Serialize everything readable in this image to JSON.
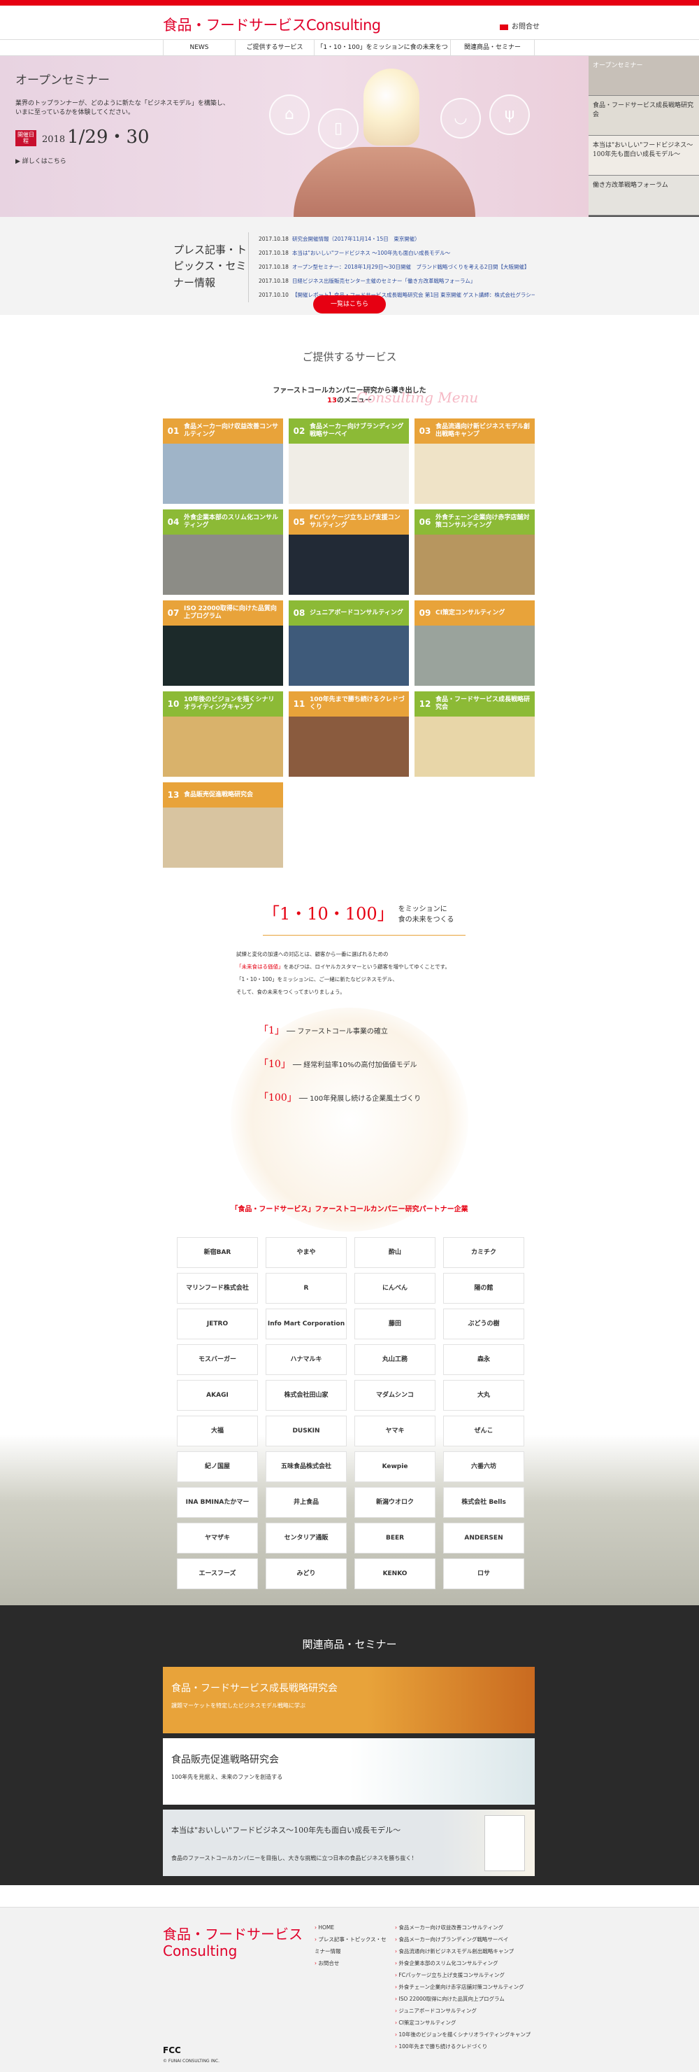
{
  "header": {
    "logo": "食品・フードサービスConsulting",
    "contact": "お問合せ",
    "nav": [
      "NEWS",
      "ご提供するサービス",
      "「1・10・100」をミッションに食の未来をつくる",
      "関連商品・セミナー"
    ]
  },
  "hero": {
    "title": "オープンセミナー",
    "desc1": "業界のトップランナーが、どのように新たな「ビジネスモデル」を構築し、",
    "desc2": "いまに至っているかを体験してください。",
    "badge": "開催日程",
    "year": "2018",
    "date": "1/29・30",
    "more": "詳しくはこちら",
    "side": [
      "オープンセミナー",
      "食品・フードサービス成長戦略研究会",
      "本当は\"おいしい\"フードビジネス〜100年先も面白い成長モデル〜",
      "働き方改革戦略フォーラム"
    ]
  },
  "news": {
    "title": "プレス記事・トピックス・セミナー情報",
    "items": [
      {
        "date": "2017.10.18",
        "text": "研究会開催情報（2017年11月14・15日　東京開催）"
      },
      {
        "date": "2017.10.18",
        "text": "本当は\"おいしい\"フードビジネス 〜100年先も面白い成長モデル〜"
      },
      {
        "date": "2017.10.18",
        "text": "オープン型セミナー：2018年1月29日〜30日開催　ブランド戦略づくりを考える2日間【大阪開催】"
      },
      {
        "date": "2017.10.18",
        "text": "日経ビジネス出版販売センター主催のセミナー「働き方改革戦略フォーラム」"
      },
      {
        "date": "2017.10.10",
        "text": "【開催レポート】食品・フードサービス成長戦略研究会 第1回 東京開催 ゲスト講師：株式会社グラシー..."
      }
    ],
    "more": "一覧はこちら"
  },
  "services": {
    "title": "ご提供するサービス",
    "lead1": "ファーストコールカンパニー研究から導き出した",
    "lead2_num": "13",
    "lead2_txt": "のメニュー",
    "script": "Consulting Menu",
    "tiles": [
      {
        "num": "01",
        "label": "食品メーカー向け収益改善コンサルティング"
      },
      {
        "num": "02",
        "label": "食品メーカー向けブランディング戦略サーベイ"
      },
      {
        "num": "03",
        "label": "食品流通向け新ビジネスモデル創出戦略キャンプ"
      },
      {
        "num": "04",
        "label": "外食企業本部のスリム化コンサルティング"
      },
      {
        "num": "05",
        "label": "FCパッケージ立ち上げ支援コンサルティング"
      },
      {
        "num": "06",
        "label": "外食チェーン企業向け赤字店舗対策コンサルティング"
      },
      {
        "num": "07",
        "label": "ISO 22000取得に向けた品質向上プログラム"
      },
      {
        "num": "08",
        "label": "ジュニアボードコンサルティング"
      },
      {
        "num": "09",
        "label": "CI策定コンサルティング"
      },
      {
        "num": "10",
        "label": "10年後のビジョンを描くシナリオライティングキャンプ"
      },
      {
        "num": "11",
        "label": "100年先まで勝ち続けるクレドづくり"
      },
      {
        "num": "12",
        "label": "食品・フードサービス成長戦略研究会"
      },
      {
        "num": "13",
        "label": "食品販売促進戦略研究会"
      }
    ]
  },
  "mission": {
    "title_mark": "「1・10・100」",
    "title_rest1": "をミッションに",
    "title_rest2": "食の未来をつくる",
    "body1": "試練と変化の加速への対応とは、顧客から一番に選ばれるための",
    "body2_red": "「未来食はる価値」",
    "body2_rest": "をあびつは、ロイヤルカスタマーという顧客を増やしてゆくことです。",
    "body3": "「1・10・100」をミッションに、ご一緒に新たなビジネスモデル、",
    "body4": "そして、食の未来をつくってまいりましょう。",
    "items": [
      {
        "mark": "「1」",
        "text": "ファーストコール事業の確立"
      },
      {
        "mark": "「10」",
        "text": "経常利益率10%の高付加価値モデル"
      },
      {
        "mark": "「100」",
        "text": "100年発展し続ける企業風土づくり"
      }
    ]
  },
  "partners": {
    "title": "「食品・フードサービス」ファーストコールカンパニー研究パートナー企業",
    "logos": [
      "新宿BAR",
      "やまや",
      "酔山",
      "カミチク",
      "マリンフード株式会社",
      "R",
      "にんべん",
      "陽の館",
      "JETRO",
      "Info Mart Corporation",
      "藤田",
      "ぶどうの樹",
      "モスバーガー",
      "ハナマルキ",
      "丸山工務",
      "森永",
      "AKAGI",
      "株式会社田山家",
      "マダムシンコ",
      "大丸",
      "大福",
      "DUSKIN",
      "ヤマキ",
      "ぜんこ",
      "紀ノ国屋",
      "五味食品株式会社",
      "Kewpie",
      "六番六坊",
      "INA BMINAたかマー",
      "井上食品",
      "新潟ウオロク",
      "株式会社 Bells",
      "ヤマザキ",
      "センタリア通販",
      "BEER",
      "ANDERSEN",
      "エースフーズ",
      "みどり",
      "KENKO",
      "ロサ"
    ]
  },
  "related": {
    "title": "関連商品・セミナー",
    "cards": [
      {
        "title": "食品・フードサービス成長戦略研究会",
        "sub": "課題マーケットを特定したビジネスモデル戦略に学ぶ"
      },
      {
        "title": "食品販売促進戦略研究会",
        "sub": "100年先を見据え、未来のファンを創造する"
      },
      {
        "title": "本当は\"おいしい\"フードビジネス〜100年先も面白い成長モデル〜",
        "sub": "食品のファーストコールカンパニーを目指し、大きな挑戦に立つ日本の食品ビジネスを勝ち抜く！"
      }
    ]
  },
  "footer": {
    "logo1": "食品・フードサービス",
    "logo2": "Consulting",
    "col1": [
      "HOME",
      "プレス記事・トピックス・セミナー情報",
      "お問合せ"
    ],
    "col2": [
      "食品メーカー向け収益改善コンサルティング",
      "食品メーカー向けブランディング戦略サーベイ",
      "食品流通向け新ビジネスモデル創出戦略キャンプ",
      "外食企業本部のスリム化コンサルティング",
      "FCパッケージ立ち上げ支援コンサルティング",
      "外食チェーン企業向け赤字店舗対策コンサルティング",
      "ISO 22000取得に向けた品質向上プログラム",
      "ジュニアボードコンサルティング",
      "CI策定コンサルティング",
      "10年後のビジョンを描くシナリオライティングキャンプ",
      "100年先まで勝ち続けるクレドづくり"
    ],
    "fcc": "FCC",
    "copyright": "© FUNAI CONSULTING INC."
  }
}
